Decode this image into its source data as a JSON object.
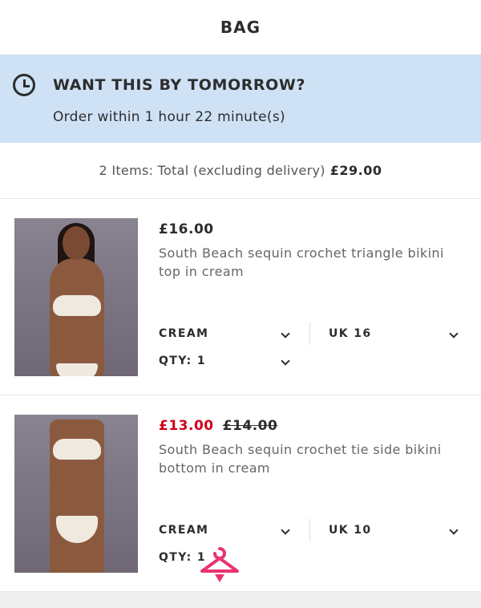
{
  "header": {
    "title": "BAG"
  },
  "promo": {
    "icon": "clock-icon",
    "title": "WANT THIS BY TOMORROW?",
    "subtitle": "Order within 1 hour 22 minute(s)",
    "background": "#cfe2f5"
  },
  "summary": {
    "label": "2 Items: Total (excluding delivery)",
    "total": "£29.00"
  },
  "items": [
    {
      "price": "£16.00",
      "title": "South Beach sequin crochet triangle bikini top in cream",
      "colour": "CREAM",
      "size": "UK 16",
      "qty": "QTY: 1"
    },
    {
      "sale_price": "£13.00",
      "original_price": "£14.00",
      "title": "South Beach sequin crochet tie side bikini bottom in cream",
      "colour": "CREAM",
      "size": "UK 10",
      "qty": "QTY: 1"
    }
  ],
  "colors": {
    "sale": "#d0021b",
    "hanger": "#e8356f"
  }
}
